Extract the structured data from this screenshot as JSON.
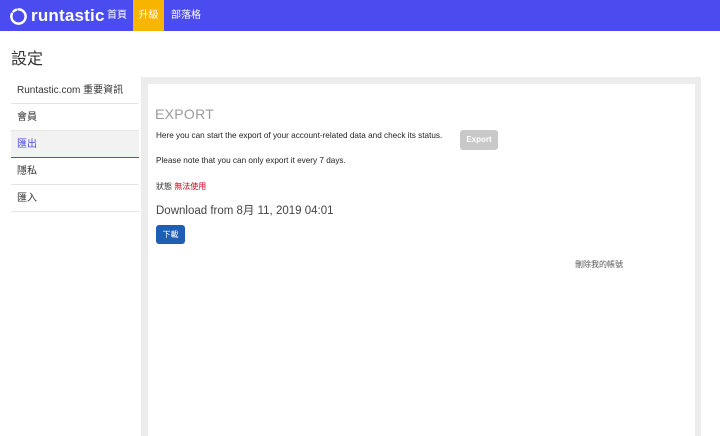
{
  "header": {
    "brand": "runtastic",
    "nav": [
      {
        "label": "首頁"
      },
      {
        "label": "升級"
      },
      {
        "label": "部落格"
      }
    ]
  },
  "page": {
    "title": "設定"
  },
  "sidebar": {
    "items": [
      {
        "label": "Runtastic.com 重要資訊"
      },
      {
        "label": "會員"
      },
      {
        "label": "匯出",
        "active": true
      },
      {
        "label": "隱私"
      },
      {
        "label": "匯入"
      }
    ]
  },
  "main": {
    "heading": "EXPORT",
    "description": "Here you can start the export of your account-related data and check its status.",
    "export_button": "Export",
    "note": "Please note that you can only export it every 7 days.",
    "status_label": "狀態",
    "status_value": "無法使用",
    "download_from": "Download from 8月 11, 2019 04:01",
    "download_button": "下載",
    "delete_account": "刪除我的帳號"
  },
  "colors": {
    "brand_bar": "#4a4cf0",
    "upgrade_highlight": "#f7b500",
    "status_unavailable": "#d0021b",
    "download_button": "#1e5fb4",
    "export_button_disabled": "#c8c8c8"
  }
}
